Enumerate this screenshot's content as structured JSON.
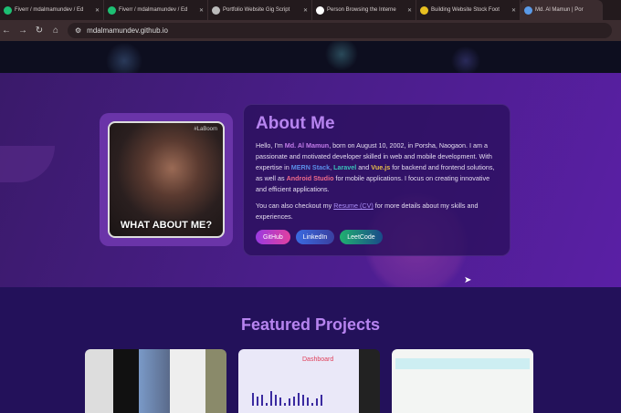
{
  "browser": {
    "tabs": [
      {
        "title": "Fiverr / mdalmamundev / Ed",
        "color": "#1dbf73"
      },
      {
        "title": "Fiverr / mdalmamundev / Ed",
        "color": "#1dbf73"
      },
      {
        "title": "Portfolio Website Gig Script",
        "color": "#bbbbbb"
      },
      {
        "title": "Person Browsing the Interne",
        "color": "#ffffff"
      },
      {
        "title": "Building Website Stock Foot",
        "color": "#e8c020"
      },
      {
        "title": "Md. Al Mamun | Por",
        "color": "#5a9ae8",
        "active": true
      }
    ],
    "url": "mdalmamundev.github.io"
  },
  "about": {
    "title": "About Me",
    "gif_caption": "WHAT ABOUT ME?",
    "gif_watermark": "#LaBoom",
    "p1": {
      "a": "Hello, I'm ",
      "name": "Md. Al Mamun",
      "b": ", born on August 10, 2002, in Porsha, Naogaon. I am a passionate and motivated developer skilled in web and mobile development. With expertise in ",
      "mern": "MERN Stack",
      "c": ", ",
      "laravel": "Laravel",
      "d": " and ",
      "vue": "Vue.js",
      "e": " for backend and frontend solutions, as well as ",
      "android": "Android Studio",
      "f": " for mobile applications. I focus on creating innovative and efficient applications."
    },
    "p2": {
      "a": "You can also checkout my ",
      "link": "Resume (CV)",
      "b": " for more details about my skills and experiences."
    },
    "buttons": [
      "GitHub",
      "LinkedIn",
      "LeetCode"
    ]
  },
  "featured": {
    "title": "Featured Projects",
    "dashboard_label": "Dashboard"
  }
}
